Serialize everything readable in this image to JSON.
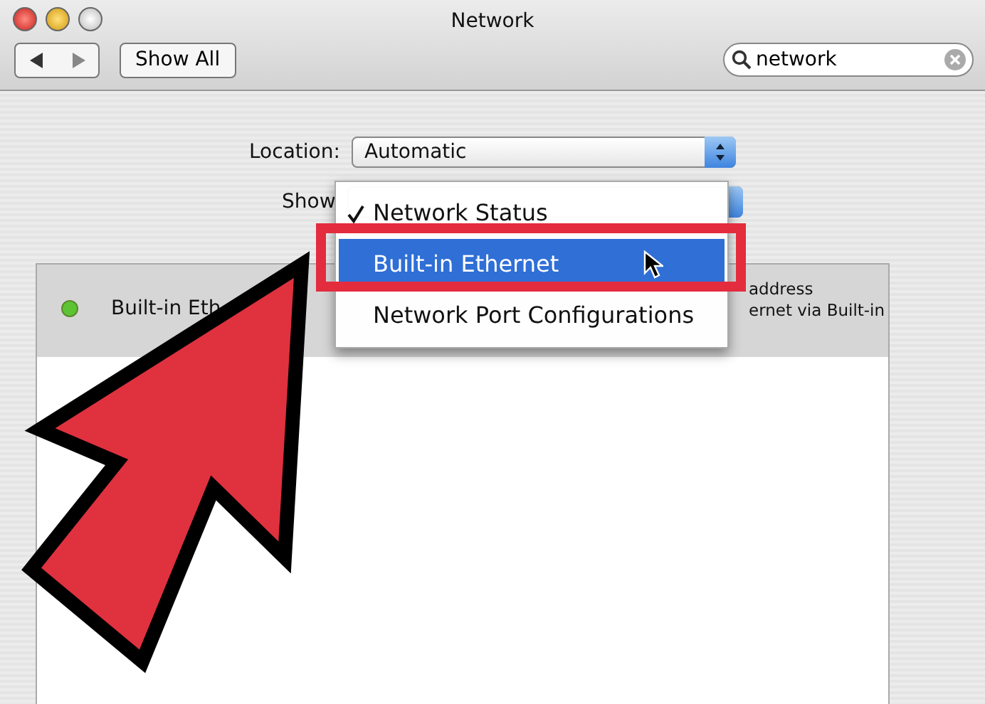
{
  "window": {
    "title": "Network"
  },
  "toolbar": {
    "show_all": "Show All",
    "search": {
      "value": "network"
    }
  },
  "location": {
    "label": "Location:",
    "value": "Automatic"
  },
  "show": {
    "label": "Show"
  },
  "menu": {
    "items": [
      {
        "label": "Network Status",
        "checked": true,
        "selected": false
      },
      {
        "label": "Built-in Ethernet",
        "checked": false,
        "selected": true
      },
      {
        "label": "Network Port Configurations",
        "checked": false,
        "selected": false
      }
    ]
  },
  "status": [
    {
      "name": "Built-in Eth",
      "color": "#5cc433",
      "detail": [
        "address",
        "ernet via Built-in"
      ]
    }
  ]
}
